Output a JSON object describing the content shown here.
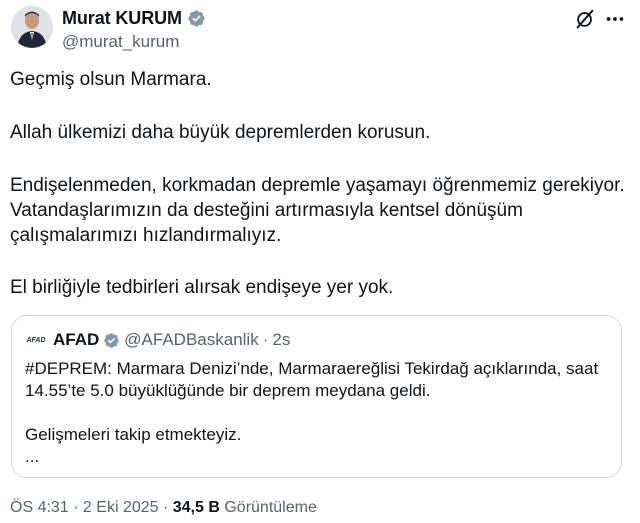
{
  "author": {
    "name": "Murat KURUM",
    "handle": "@murat_kurum"
  },
  "tweet": {
    "paragraphs": [
      "Geçmiş olsun Marmara.",
      "Allah ülkemizi daha büyük depremlerden korusun.",
      "Endişelenmeden, korkmadan depremle yaşamayı öğrenmemiz gerekiyor. Vatandaşlarımızın da desteğini artırmasıyla kentsel dönüşüm çalışmalarımızı hızlandırmalıyız.",
      "El birliğiyle tedbirleri alırsak endişeye yer yok."
    ]
  },
  "quote": {
    "logo_text": "AFAD",
    "name": "AFAD",
    "handle": "@AFADBaskanlik",
    "separator": "·",
    "time": "2s",
    "text_line1": "#DEPREM: Marmara Denizi’nde, Marmaraereğlisi Tekirdağ açıklarında, saat 14.55’te 5.0 büyüklüğünde bir deprem meydana geldi.",
    "text_line2": "Gelişmeleri takip etmekteyiz.",
    "text_line3": "..."
  },
  "meta": {
    "time": "ÖS 4:31",
    "separator1": " · ",
    "date": "2 Eki 2025",
    "separator2": " · ",
    "views_count": "34,5 B",
    "views_label": "Görüntüleme"
  },
  "colors": {
    "text": "#0f1419",
    "secondary": "#536471",
    "border": "#cfd9de",
    "verified": "#829aab"
  },
  "icons": [
    "verified-badge-icon",
    "grok-icon",
    "more-icon"
  ]
}
